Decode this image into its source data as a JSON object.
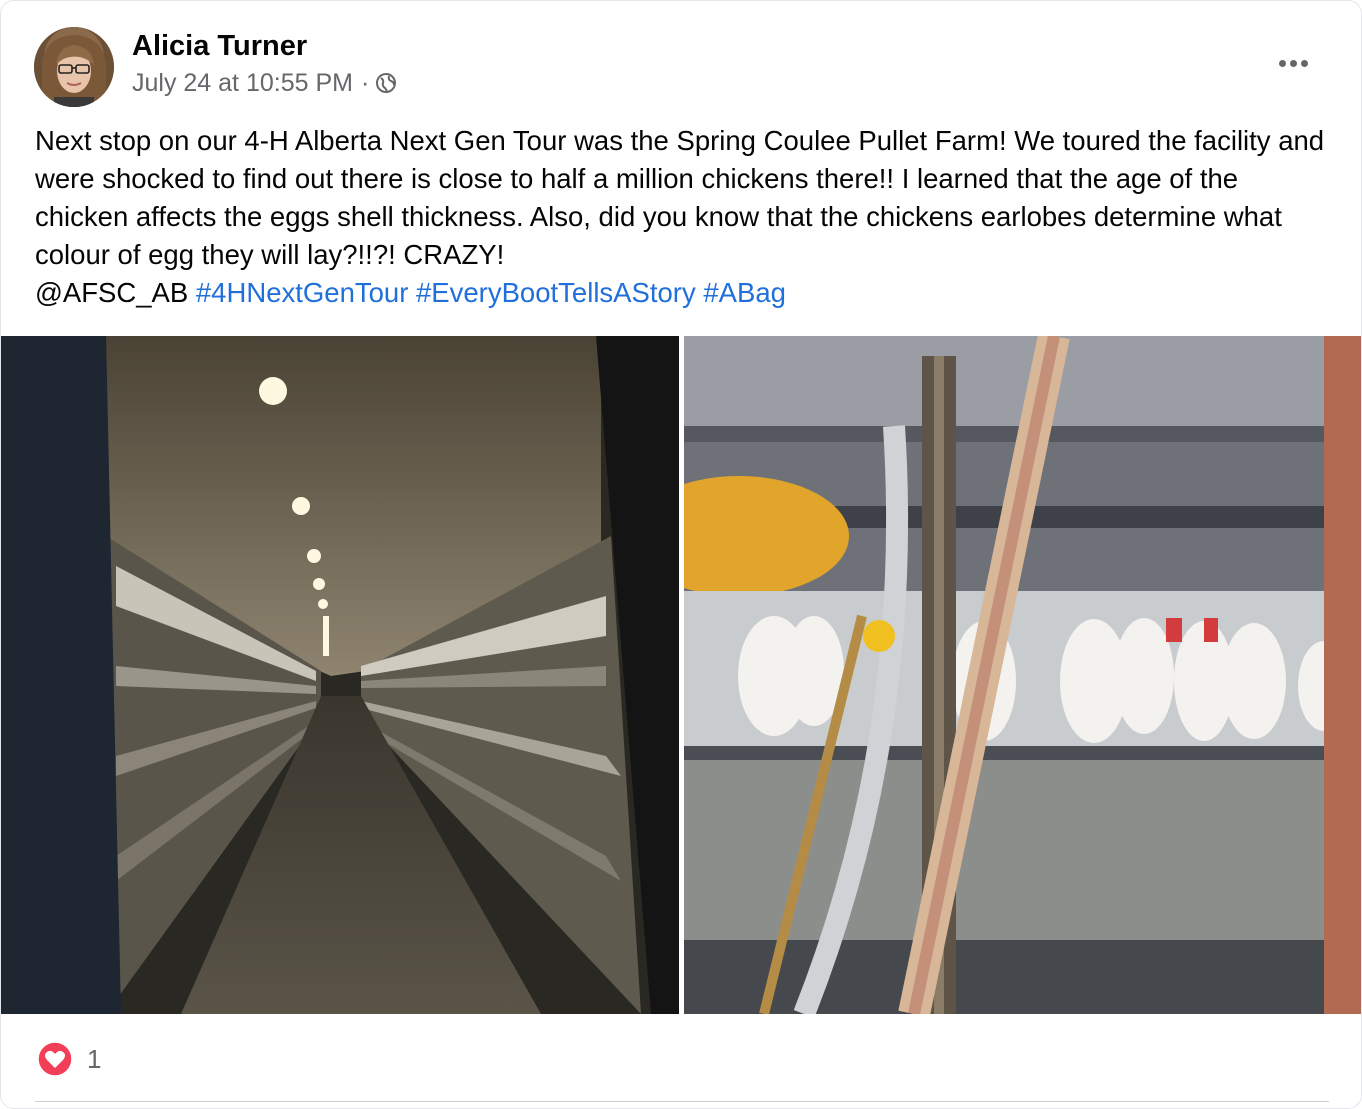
{
  "post": {
    "author": "Alicia Turner",
    "timestamp": "July 24 at 10:55 PM",
    "separator": "·",
    "privacy_icon": "globe-icon",
    "more_icon": "more-horizontal-icon",
    "text_paragraph": "Next stop on our 4-H Alberta Next Gen Tour was the Spring Coulee Pullet Farm! We toured the facility and were shocked to find out there is close to half a million chickens there!! I learned that the age of the chicken affects the eggs shell thickness. Also, did you know that the chickens earlobes determine what colour of egg they will lay?!!?! CRAZY!",
    "mention": "@AFSC_AB",
    "hashtags": [
      "#4HNextGenTour",
      "#EveryBootTellsAStory",
      "#ABag"
    ],
    "photos": [
      {
        "name": "barn-aisle-photo",
        "subject": "long poultry barn aisle with cage rows and ceiling lights"
      },
      {
        "name": "pullet-cages-photo",
        "subject": "white pullets in wire cages behind pipes and chain"
      }
    ]
  },
  "reactions": {
    "icon": "heart-icon",
    "count": "1"
  },
  "colors": {
    "text": "#050505",
    "secondary_text": "#65676b",
    "hashtag": "#216fdb",
    "heart": "#f33e58",
    "divider": "#ced0d4"
  }
}
